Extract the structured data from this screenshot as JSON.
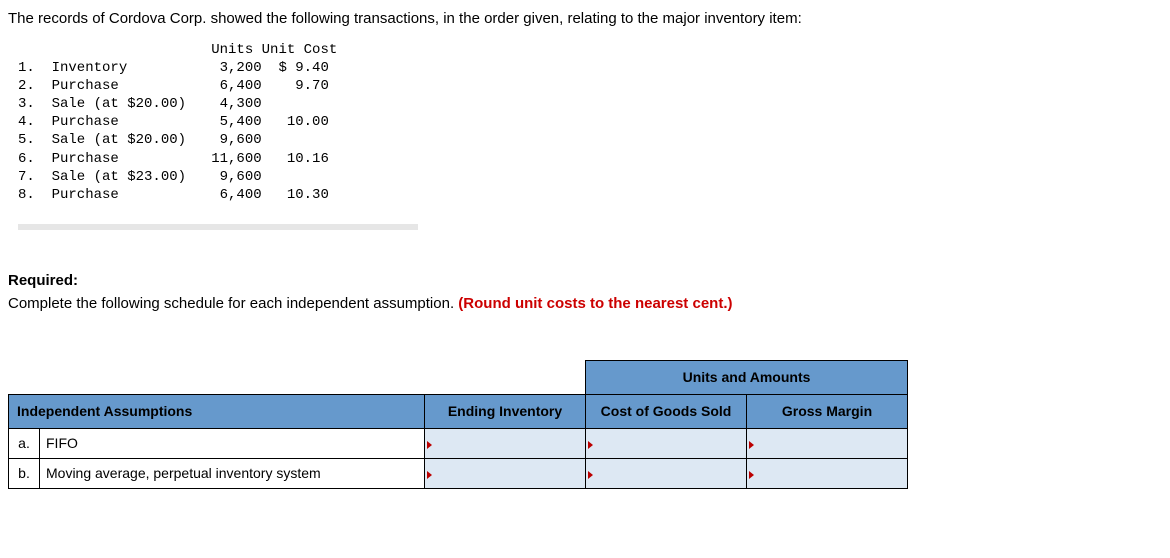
{
  "intro": "The records of Cordova Corp. showed the following transactions, in the order given, relating to the major inventory item:",
  "trans_header": {
    "units": "Units",
    "unit_cost": "Unit Cost"
  },
  "transactions": [
    {
      "num": "1.",
      "desc": "Inventory",
      "units": "3,200",
      "unit_cost": "$ 9.40"
    },
    {
      "num": "2.",
      "desc": "Purchase",
      "units": "6,400",
      "unit_cost": "9.70"
    },
    {
      "num": "3.",
      "desc": "Sale (at $20.00)",
      "units": "4,300",
      "unit_cost": ""
    },
    {
      "num": "4.",
      "desc": "Purchase",
      "units": "5,400",
      "unit_cost": "10.00"
    },
    {
      "num": "5.",
      "desc": "Sale (at $20.00)",
      "units": "9,600",
      "unit_cost": ""
    },
    {
      "num": "6.",
      "desc": "Purchase",
      "units": "11,600",
      "unit_cost": "10.16"
    },
    {
      "num": "7.",
      "desc": "Sale (at $23.00)",
      "units": "9,600",
      "unit_cost": ""
    },
    {
      "num": "8.",
      "desc": "Purchase",
      "units": "6,400",
      "unit_cost": "10.30"
    }
  ],
  "required_label": "Required:",
  "required_text": "Complete the following schedule for each independent assumption. ",
  "required_red": "(Round unit costs to the nearest cent.)",
  "table": {
    "header_units_amounts": "Units and Amounts",
    "header_assumptions": "Independent Assumptions",
    "header_ending_inventory": "Ending Inventory",
    "header_cogs": "Cost of Goods Sold",
    "header_gross_margin": "Gross Margin",
    "rows": [
      {
        "letter": "a.",
        "assumption": "FIFO"
      },
      {
        "letter": "b.",
        "assumption": "Moving average, perpetual inventory system"
      }
    ]
  }
}
